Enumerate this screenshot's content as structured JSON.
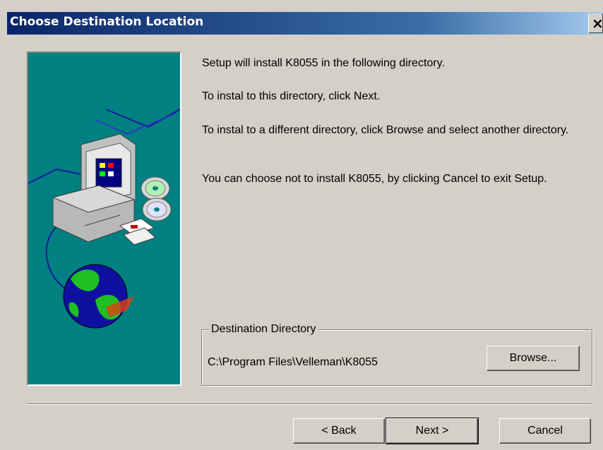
{
  "window": {
    "title": "Choose Destination Location",
    "close_glyph": "×"
  },
  "body_text": {
    "line1": "Setup will install K8055 in the following directory.",
    "line2": "To instal to this directory, click Next.",
    "line3": "To instal to a different directory, click Browse and select another directory.",
    "line4": "You can choose not to install K8055, by clicking Cancel to exit Setup."
  },
  "destination": {
    "group_label": "Destination Directory",
    "path": "C:\\Program Files\\Velleman\\K8055",
    "browse_label": "Browse..."
  },
  "buttons": {
    "back": "< Back",
    "next": "Next >",
    "cancel": "Cancel"
  },
  "colors": {
    "dialog_bg": "#d4d0c8",
    "art_bg": "#008080",
    "titlebar": "#0a246a"
  },
  "icons": [
    "computer-icon",
    "cd-icon",
    "floppy-icon",
    "globe-icon",
    "close-icon"
  ]
}
